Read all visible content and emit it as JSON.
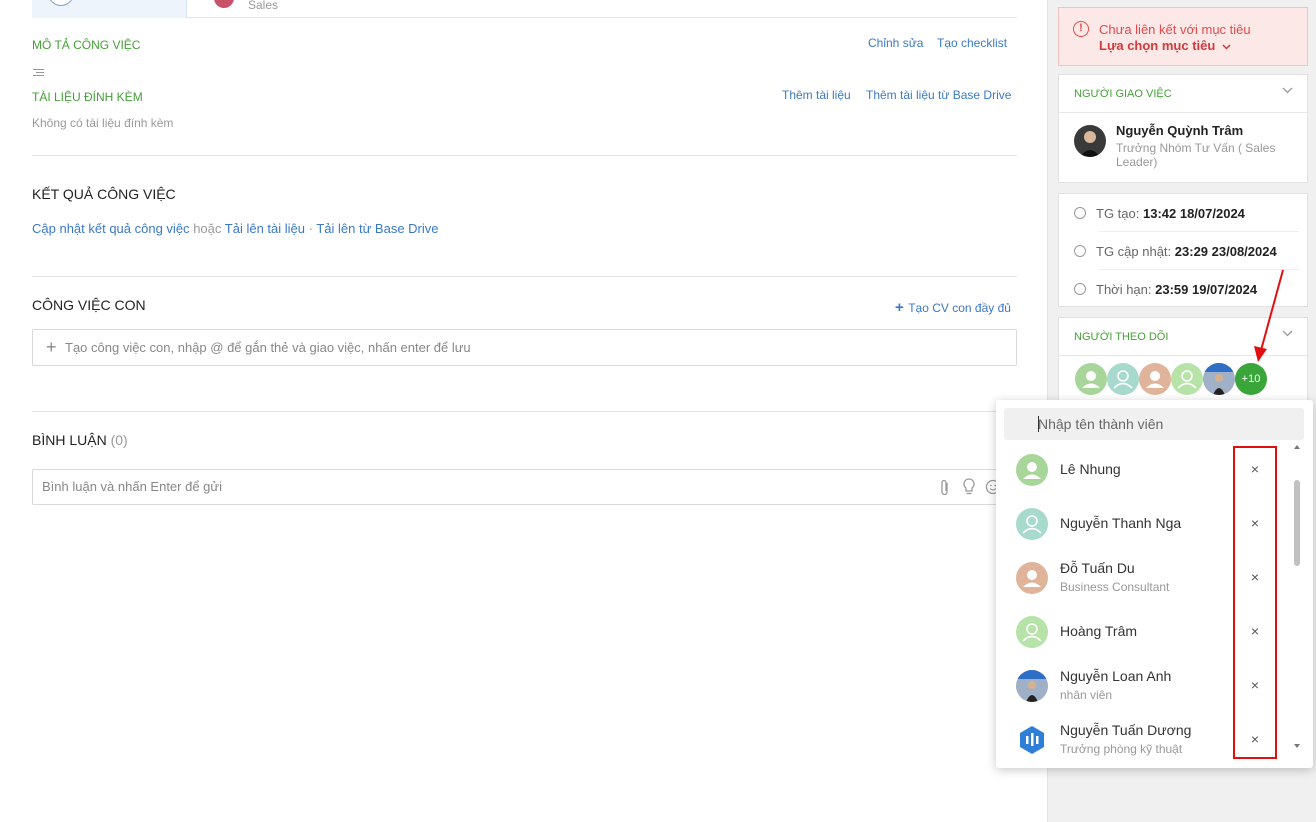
{
  "top": {
    "sub_label": "Sales"
  },
  "description": {
    "title": "MÔ TẢ CÔNG VIỆC",
    "edit_link": "Chỉnh sửa",
    "checklist_link": "Tạo checklist"
  },
  "attachments": {
    "title": "TÀI LIỆU ĐÍNH KÈM",
    "add_link": "Thêm tài liệu",
    "add_drive_link": "Thêm tài liệu từ Base Drive",
    "empty_text": "Không có tài liệu đính kèm"
  },
  "results": {
    "title": "KẾT QUẢ CÔNG VIỆC",
    "update_link": "Cập nhật kết quả công việc",
    "or_text": "hoặc",
    "upload_link": "Tải lên tài liệu",
    "sep": "·",
    "upload_drive_link": "Tải lên từ Base Drive"
  },
  "subtasks": {
    "title": "CÔNG VIỆC CON",
    "create_full_link": "Tạo CV con đầy đủ",
    "input_placeholder": "Tạo công việc con, nhập @ để gắn thẻ và giao việc, nhấn enter để lưu"
  },
  "comments": {
    "title": "BÌNH LUẬN",
    "count": "(0)",
    "input_placeholder": "Bình luận và nhấn Enter để gửi"
  },
  "goal_warning": {
    "text": "Chưa liên kết với mục tiêu",
    "action": "Lựa chọn mục tiêu"
  },
  "assigner": {
    "title": "NGƯỜI GIAO VIỆC",
    "name": "Nguyễn Quỳnh Trâm",
    "role": "Trưởng Nhóm Tư Vấn ( Sales Leader)"
  },
  "times": {
    "created_label": "TG tạo:",
    "created_value": "13:42 18/07/2024",
    "updated_label": "TG cập nhật:",
    "updated_value": "23:29 23/08/2024",
    "deadline_label": "Thời hạn:",
    "deadline_value": "23:59 19/07/2024"
  },
  "followers": {
    "title": "NGƯỜI THEO DÕI",
    "more_count": "+10"
  },
  "member_picker": {
    "search_placeholder": "Nhập tên thành viên",
    "members": [
      {
        "name": "Lê Nhung",
        "subtitle": ""
      },
      {
        "name": "Nguyễn Thanh Nga",
        "subtitle": ""
      },
      {
        "name": "Đỗ Tuấn Du",
        "subtitle": "Business Consultant"
      },
      {
        "name": "Hoàng Trâm",
        "subtitle": ""
      },
      {
        "name": "Nguyễn Loan Anh",
        "subtitle": "nhân viên"
      },
      {
        "name": "Nguyễn Tuấn Dương",
        "subtitle": "Trưởng phòng kỹ thuật"
      }
    ],
    "remove_glyph": "×"
  },
  "colors": {
    "green": "#45a037",
    "link": "#3b79c6",
    "danger": "#e14b4b",
    "highlight": "#e01010"
  }
}
